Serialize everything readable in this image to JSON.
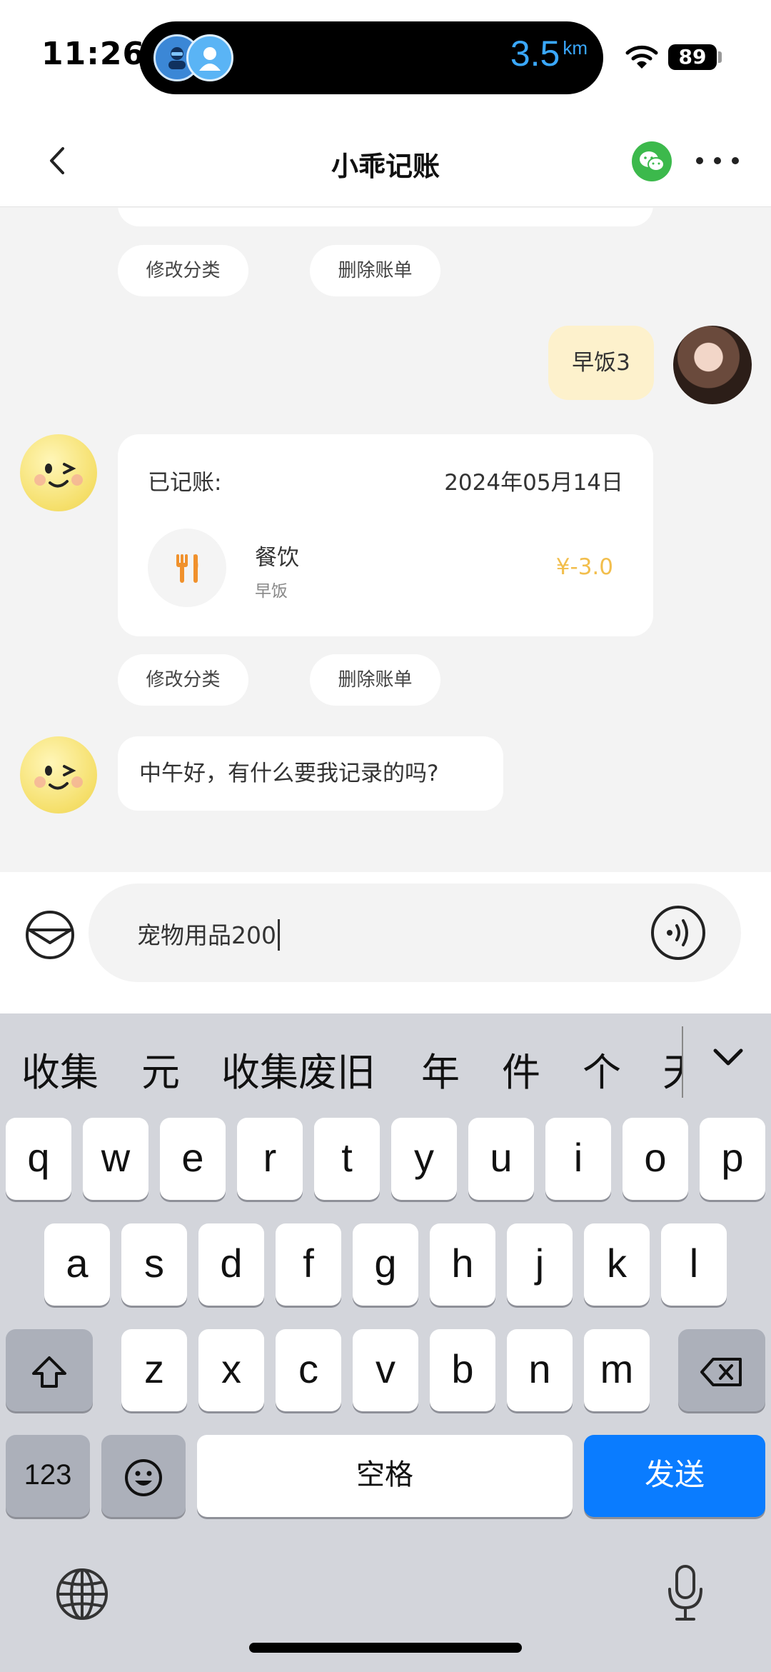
{
  "status_bar": {
    "time": "11:26",
    "distance_value": "3.5",
    "distance_unit": "km",
    "battery": "89"
  },
  "nav": {
    "title": "小乖记账"
  },
  "chat": {
    "top_actions": {
      "edit": "修改分类",
      "delete": "删除账单"
    },
    "user_message": "早饭3",
    "bill_card": {
      "recorded_label": "已记账:",
      "date": "2024年05月14日",
      "category": "餐饮",
      "note": "早饭",
      "amount": "¥-3.0"
    },
    "card_actions": {
      "edit": "修改分类",
      "delete": "删除账单"
    },
    "bot_message": "中午好，有什么要我记录的吗?"
  },
  "input": {
    "value": "宠物用品200"
  },
  "keyboard": {
    "candidates": [
      "收集",
      "元",
      "收集废旧",
      "年",
      "件",
      "个",
      "天"
    ],
    "row1": [
      "q",
      "w",
      "e",
      "r",
      "t",
      "y",
      "u",
      "i",
      "o",
      "p"
    ],
    "row2": [
      "a",
      "s",
      "d",
      "f",
      "g",
      "h",
      "j",
      "k",
      "l"
    ],
    "row3": [
      "z",
      "x",
      "c",
      "v",
      "b",
      "n",
      "m"
    ],
    "numbers_label": "123",
    "space_label": "空格",
    "send_label": "发送"
  },
  "colors": {
    "accent_blue": "#0a7cff",
    "amount_color": "#f2be4c",
    "user_bubble": "#fdf1cc",
    "wechat_green": "#3cb94c"
  }
}
